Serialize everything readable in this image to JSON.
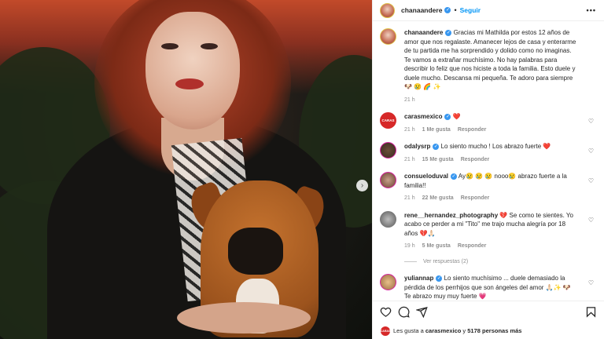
{
  "post": {
    "author": "chanaandere",
    "follow_label": "Seguir",
    "more_label": "•••",
    "next_arrow": "›"
  },
  "caption": {
    "author": "chanaandere",
    "text": "Gracias mi Mathilda por estos 12 años de amor que nos regalaste. Amanecer lejos de casa y enterarme de tu partida me ha sorprendido y dolido como no imaginas. Te vamos a extrañar muchísimo. No hay palabras para describir lo feliz que nos hiciste a toda la familia. Esto duele y duele mucho. Descansa mi pequeña. Te adoro para siempre 🐶 😢 🌈 ✨",
    "time": "21 h"
  },
  "comments": [
    {
      "user": "carasmexico",
      "avatar_text": "CARAS",
      "text": "❤️",
      "time": "21 h",
      "likes": "1 Me gusta",
      "reply": "Responder"
    },
    {
      "user": "odalysrp",
      "text": "Lo siento mucho ! Los abrazo fuerte ❤️",
      "time": "21 h",
      "likes": "15 Me gusta",
      "reply": "Responder"
    },
    {
      "user": "consueloduval",
      "text": "Ay😢 😢 😢 nooo😢 abrazo fuerte a la familia!!",
      "time": "21 h",
      "likes": "22 Me gusta",
      "reply": "Responder"
    },
    {
      "user": "rene__hernandez_photography",
      "text": "💔 Se como te sientes. Yo acabo ce perder a mi \"Tito\" me trajo mucha alegría por 18 años 💔🙏🏻",
      "time": "19 h",
      "likes": "5 Me gusta",
      "reply": "Responder",
      "view_replies": "Ver respuestas (2)"
    },
    {
      "user": "yuliannap",
      "text": "Lo siento muchísimo ... duele demasiado la pérdida de los perrhijos que son ángeles del amor 🙏🏻✨ 🐶 Te abrazo muy muy fuerte 💗"
    }
  ],
  "likes_bar": {
    "prefix": "Les gusta a",
    "user": "carasmexico",
    "middle": "y",
    "count": "5178 personas más",
    "mini_avatar_text": "CARAS"
  },
  "icons": [
    "heart-icon",
    "comment-icon",
    "share-icon",
    "bookmark-icon",
    "verified-badge-icon",
    "more-options-icon",
    "next-arrow-icon"
  ],
  "colors": {
    "accent": "#0095f6",
    "verified": "#3897f0",
    "like": "#ed4956",
    "meta": "#8e8e8e"
  }
}
